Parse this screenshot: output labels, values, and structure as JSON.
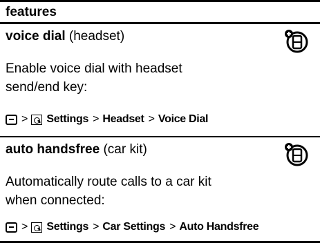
{
  "header": {
    "title": "features"
  },
  "features": [
    {
      "title_bold": "voice dial",
      "title_rest": " (headset)",
      "desc_lines": [
        "Enable voice dial with headset",
        "send/end key:"
      ],
      "path": [
        "Settings",
        "Headset",
        "Voice Dial"
      ],
      "separator": ">",
      "icon": "optional-feature-phone-icon"
    },
    {
      "title_bold": "auto handsfree",
      "title_rest": " (car kit)",
      "desc_lines": [
        "Automatically route calls to a car kit",
        "when connected:"
      ],
      "path": [
        "Settings",
        "Car Settings",
        "Auto Handsfree"
      ],
      "separator": ">",
      "icon": "optional-feature-phone-icon"
    }
  ]
}
